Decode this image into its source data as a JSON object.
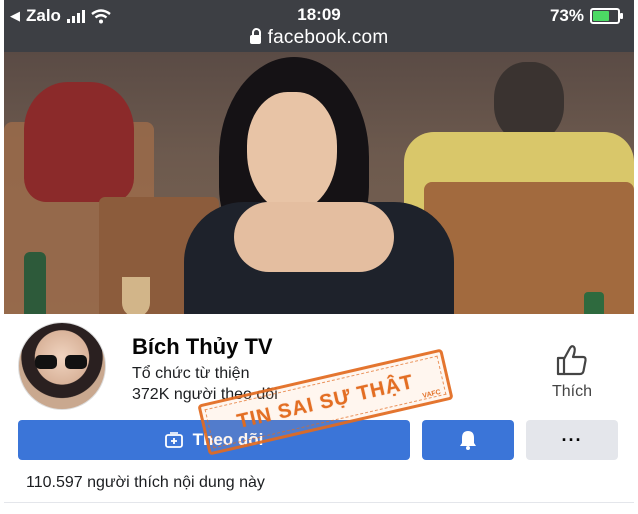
{
  "status_bar": {
    "carrier": "Zalo",
    "time": "18:09",
    "battery_percent": "73%",
    "battery_level": 0.73
  },
  "browser": {
    "url": "facebook.com"
  },
  "page": {
    "name": "Bích Thủy TV",
    "category": "Tổ chức từ thiện",
    "followers": "372K người theo dõi",
    "like_label": "Thích",
    "follow_label": "Theo dõi",
    "more_label": "···",
    "likes_summary": "110.597 người thích nội dung này"
  },
  "stamp": {
    "text": "TIN SAI SỰ THẬT",
    "mark": "VAFC",
    "color": "#e26a1e"
  },
  "colors": {
    "accent": "#3b75d8",
    "statusbar_bg": "#3d3f44",
    "battery_fill": "#4cd964"
  },
  "icons": [
    "back-arrow-icon",
    "signal-icon",
    "wifi-icon",
    "battery-icon",
    "lock-icon",
    "thumbs-up-icon",
    "follow-plus-icon",
    "bell-icon",
    "more-icon"
  ]
}
